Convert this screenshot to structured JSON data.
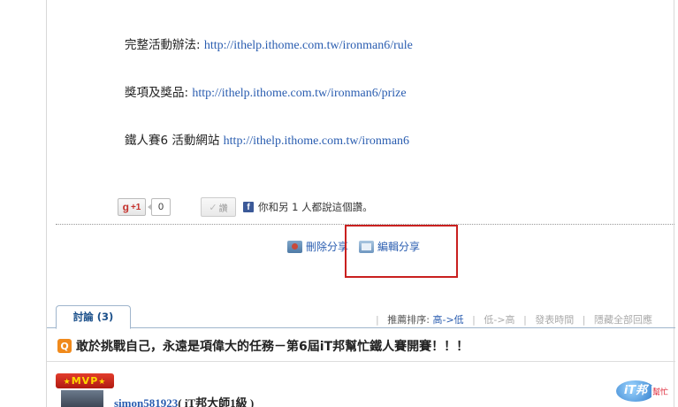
{
  "info_lines": [
    {
      "label": "完整活動辦法: ",
      "url": "http://ithelp.ithome.com.tw/ironman6/rule"
    },
    {
      "label": "獎項及獎品: ",
      "url": "http://ithelp.ithome.com.tw/ironman6/prize"
    },
    {
      "label": "鐵人賽6 活動網站 ",
      "url": "http://ithelp.ithome.com.tw/ironman6"
    }
  ],
  "social": {
    "gplus_label": "+1",
    "gplus_letter": "g",
    "gplus_count": "0",
    "like_label": "讚",
    "fb_icon": "f",
    "fb_text": "你和另 1 人都說這個讚。"
  },
  "actions": {
    "delete_share": "刪除分享",
    "edit_share": "編輯分享"
  },
  "discussion": {
    "tab_label": "討論 (3)",
    "sort_label": "推薦排序:",
    "sort_high_low": "高->低",
    "sort_low_high": "低->高",
    "sort_time": "發表時間",
    "hide_replies": "隱藏全部回應"
  },
  "topic": {
    "icon_letter": "Q",
    "title": "敢於挑戰自己，永遠是項偉大的任務－第6屆iT邦幫忙鐵人賽開賽！！！"
  },
  "post": {
    "badge": "MVP",
    "username": "simon581923",
    "rank": "( iT邦大師1級 )"
  },
  "logo": {
    "text": "iT邦",
    "sub": "幫忙"
  },
  "colors": {
    "link": "#2a5db0",
    "highlight_box": "#c9201f",
    "mvp_badge": "#b01a10",
    "q_icon": "#f08a1c"
  }
}
